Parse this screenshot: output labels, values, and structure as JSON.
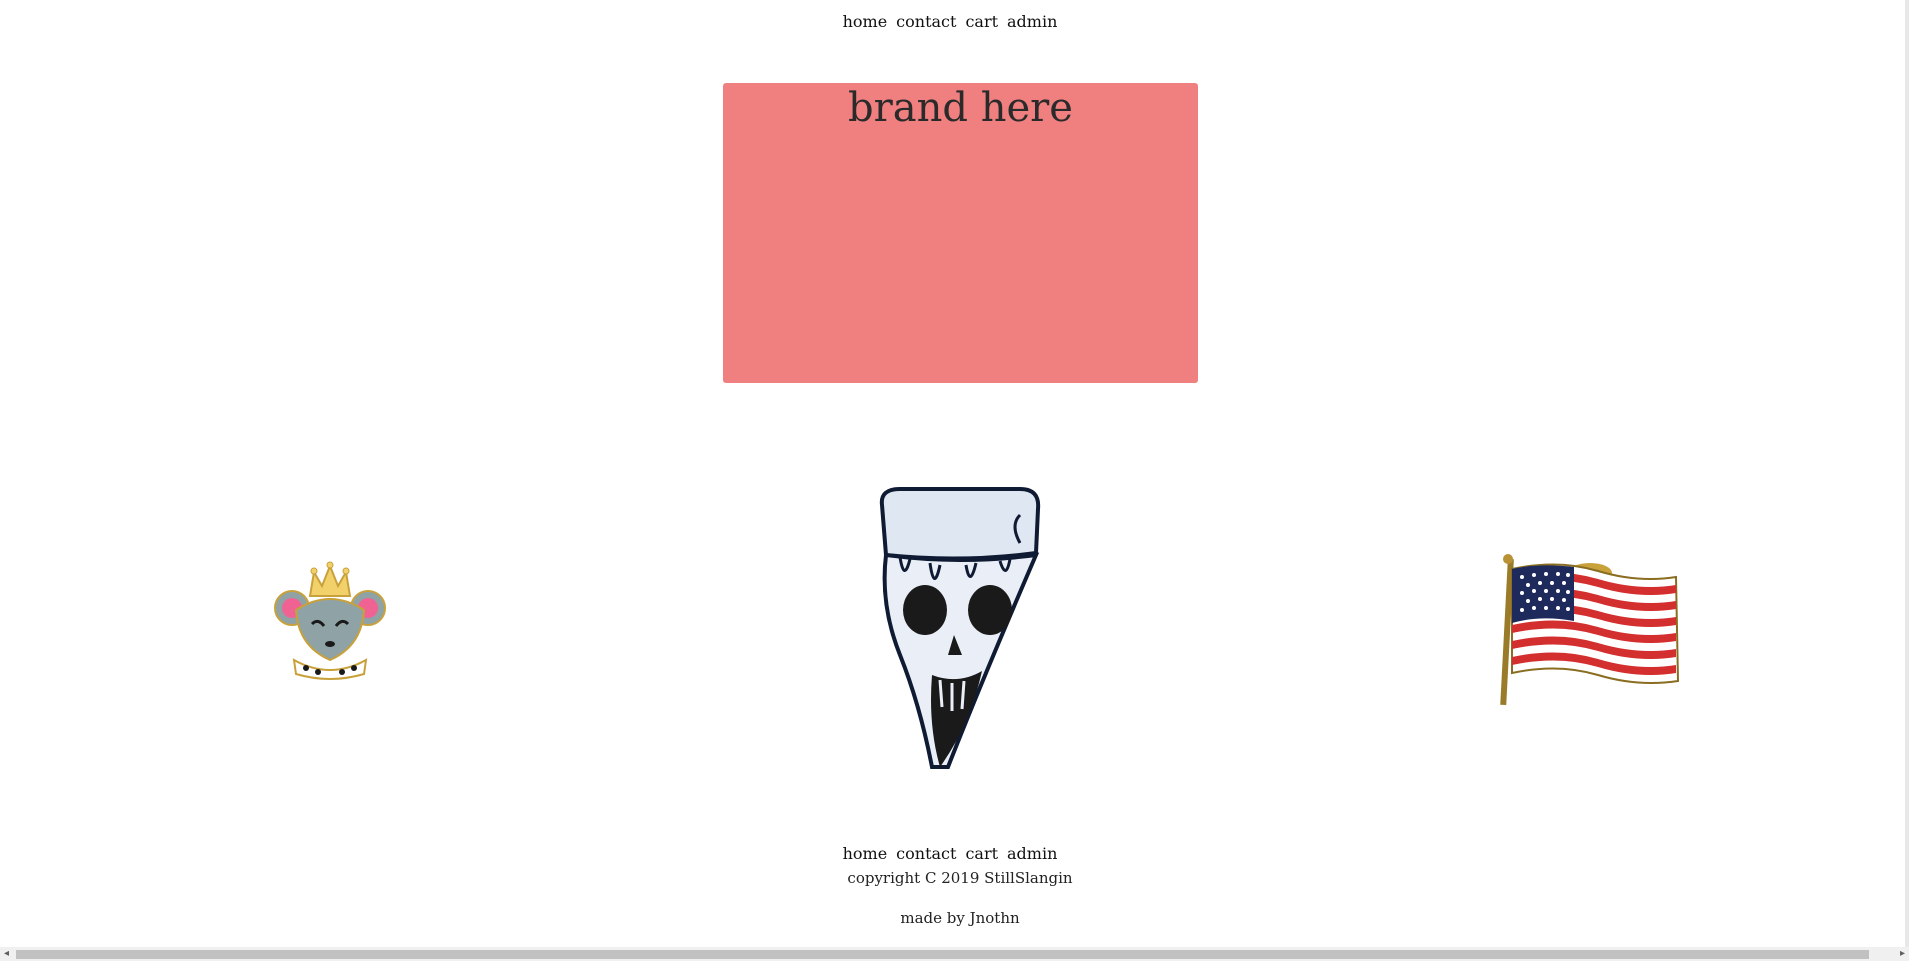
{
  "nav": {
    "home": "home",
    "contact": "contact",
    "cart": "cart",
    "admin": "admin"
  },
  "brand": {
    "title": "brand here",
    "background": "#f08080"
  },
  "products": [
    {
      "icon": "crowned-mouse-pin-icon"
    },
    {
      "icon": "skull-pizza-pin-icon"
    },
    {
      "icon": "american-flag-pin-icon"
    }
  ],
  "footer": {
    "nav": {
      "home": "home",
      "contact": "contact",
      "cart": "cart",
      "admin": "admin"
    },
    "copyright": "copyright C 2019 StillSlangin",
    "made_by": "made by Jnothn"
  },
  "scrollbar": {
    "left_arrow": "◂",
    "right_arrow": "▸"
  }
}
